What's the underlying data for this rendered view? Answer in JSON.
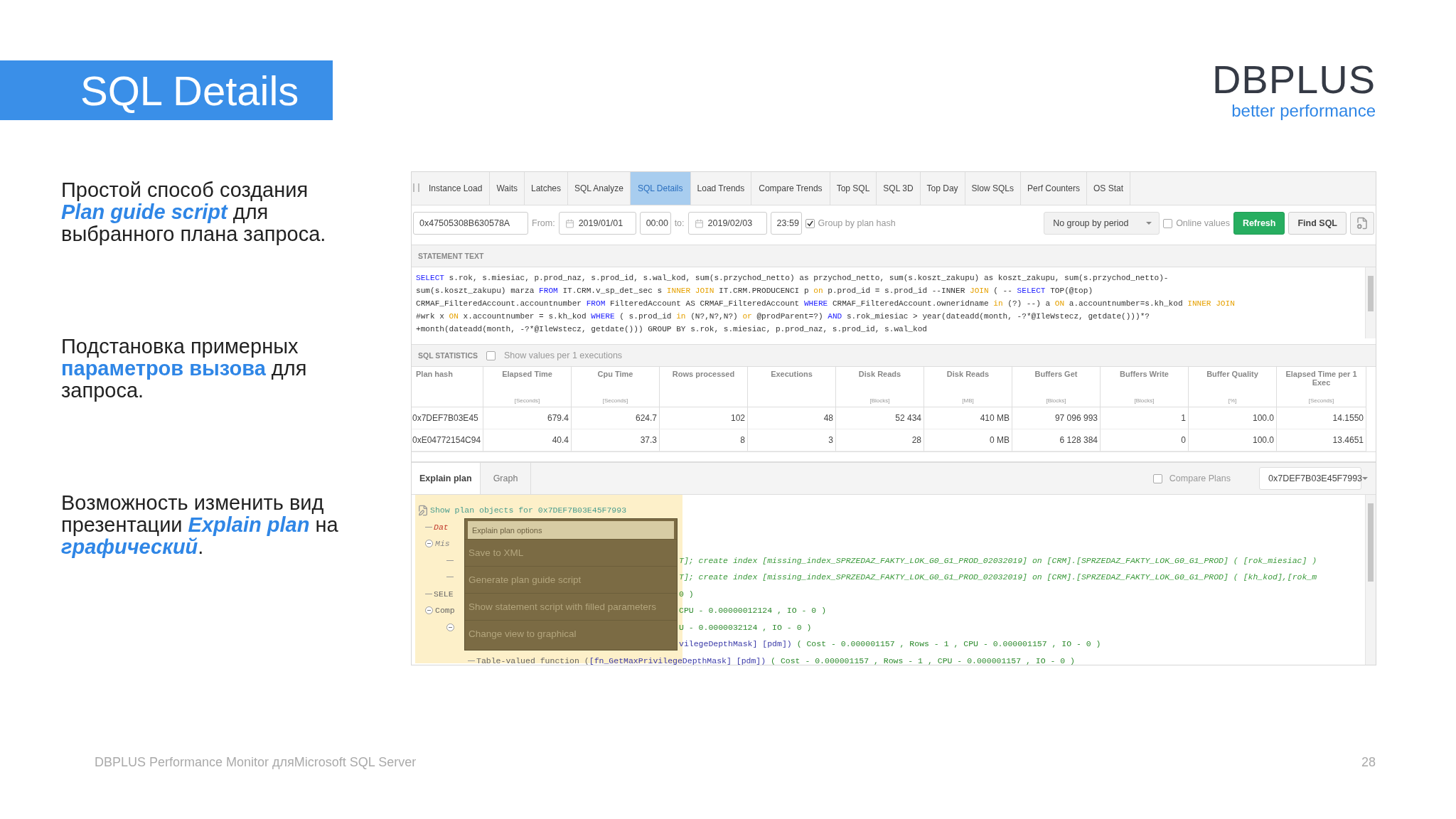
{
  "slide": {
    "title": "SQL Details",
    "logo": {
      "name": "DBPLUS",
      "tagline": "better performance"
    },
    "notes": [
      "Простой способ создания *Plan guide script* для выбранного плана запроса.",
      "Подстановка примерных **параметров вызова** для запроса.",
      "Возможность изменить вид презентации *Explain plan* на *графический*."
    ],
    "footer": {
      "text": "DBPLUS Performance Monitor дляMicrosoft SQL Server",
      "page": "28"
    }
  },
  "app": {
    "tabs": [
      {
        "label": "Instance Load",
        "selected": false
      },
      {
        "label": "Waits",
        "selected": false
      },
      {
        "label": "Latches",
        "selected": false
      },
      {
        "label": "SQL Analyze",
        "selected": false
      },
      {
        "label": "SQL Details",
        "selected": true
      },
      {
        "label": "Load Trends",
        "selected": false
      },
      {
        "label": "Compare Trends",
        "selected": false
      },
      {
        "label": "Top SQL",
        "selected": false
      },
      {
        "label": "SQL 3D",
        "selected": false
      },
      {
        "label": "Top Day",
        "selected": false
      },
      {
        "label": "Slow SQLs",
        "selected": false
      },
      {
        "label": "Perf Counters",
        "selected": false
      },
      {
        "label": "OS Stat",
        "selected": false
      }
    ],
    "toolbar": {
      "sql_hash": "0x47505308B630578A",
      "from_label": "From:",
      "from_date": "2019/01/01",
      "from_time": "00:00",
      "to_label": "to:",
      "to_date": "2019/02/03",
      "to_time": "23:59",
      "group_by_plan_hash": {
        "label": "Group by plan hash",
        "checked": true
      },
      "period": "No group by period",
      "online_values": {
        "label": "Online values",
        "checked": false
      },
      "refresh": "Refresh",
      "find_sql": "Find SQL"
    },
    "statement": {
      "title": "STATEMENT TEXT",
      "lines": [
        [
          {
            "kind": "kw",
            "text": "SELECT"
          },
          {
            "kind": "txt",
            "text": " s.rok, s.miesiac, p.prod_naz, s.prod_id, s.wal_kod, sum(s.przychod_netto) as przychod_netto, sum(s.koszt_zakupu) as koszt_zakupu, sum(s.przychod_netto)-"
          }
        ],
        [
          {
            "kind": "txt",
            "text": "sum(s.koszt_zakupu) marza "
          },
          {
            "kind": "kw",
            "text": "FROM"
          },
          {
            "kind": "txt",
            "text": " IT.CRM.v_sp_det_sec s "
          },
          {
            "kind": "op",
            "text": "INNER JOIN"
          },
          {
            "kind": "txt",
            "text": " IT.CRM.PRODUCENCI p "
          },
          {
            "kind": "op",
            "text": "on"
          },
          {
            "kind": "txt",
            "text": " p.prod_id = s.prod_id --INNER "
          },
          {
            "kind": "op",
            "text": "JOIN"
          },
          {
            "kind": "txt",
            "text": " ( -- "
          },
          {
            "kind": "kw",
            "text": "SELECT"
          },
          {
            "kind": "txt",
            "text": " TOP(@top)"
          }
        ],
        [
          {
            "kind": "txt",
            "text": "CRMAF_FilteredAccount.accountnumber "
          },
          {
            "kind": "kw",
            "text": "FROM"
          },
          {
            "kind": "txt",
            "text": " FilteredAccount AS CRMAF_FilteredAccount "
          },
          {
            "kind": "kw",
            "text": "WHERE"
          },
          {
            "kind": "txt",
            "text": " CRMAF_FilteredAccount.owneridname "
          },
          {
            "kind": "op",
            "text": "in"
          },
          {
            "kind": "txt",
            "text": " (?) --) a "
          },
          {
            "kind": "op",
            "text": "ON"
          },
          {
            "kind": "txt",
            "text": " a.accountnumber=s.kh_kod "
          },
          {
            "kind": "op",
            "text": "INNER JOIN"
          }
        ],
        [
          {
            "kind": "txt",
            "text": "#wrk x "
          },
          {
            "kind": "op",
            "text": "ON"
          },
          {
            "kind": "txt",
            "text": " x.accountnumber = s.kh_kod "
          },
          {
            "kind": "kw",
            "text": "WHERE"
          },
          {
            "kind": "txt",
            "text": " ( s.prod_id "
          },
          {
            "kind": "op",
            "text": "in"
          },
          {
            "kind": "txt",
            "text": " (N?,N?,N?) "
          },
          {
            "kind": "op",
            "text": "or"
          },
          {
            "kind": "txt",
            "text": " @prodParent=?) "
          },
          {
            "kind": "kw",
            "text": "AND"
          },
          {
            "kind": "txt",
            "text": " s.rok_miesiac > year(dateadd(month, -?*@IleWstecz, getdate()))*?"
          }
        ],
        [
          {
            "kind": "txt",
            "text": "+month(dateadd(month, -?*@IleWstecz, getdate())) GROUP BY s.rok, s.miesiac, p.prod_naz, s.prod_id, s.wal_kod"
          }
        ]
      ]
    },
    "statistics": {
      "title": "SQL STATISTICS",
      "per_exec": {
        "label": "Show values per 1 executions",
        "checked": false
      },
      "columns": [
        {
          "label": "Plan hash"
        },
        {
          "label": "Elapsed Time",
          "unit": "[Seconds]"
        },
        {
          "label": "Cpu Time",
          "unit": "[Seconds]"
        },
        {
          "label": "Rows processed"
        },
        {
          "label": "Executions"
        },
        {
          "label": "Disk Reads",
          "unit": "[Blocks]"
        },
        {
          "label": "Disk Reads",
          "unit": "[MB]"
        },
        {
          "label": "Buffers Get",
          "unit": "[Blocks]"
        },
        {
          "label": "Buffers Write",
          "unit": "[Blocks]"
        },
        {
          "label": "Buffer Quality",
          "unit": "[%]"
        },
        {
          "label": "Elapsed Time per 1 Exec",
          "unit": "[Seconds]"
        }
      ],
      "rows": [
        [
          "0x7DEF7B03E45",
          "679.4",
          "624.7",
          "102",
          "48",
          "52 434",
          "410 MB",
          "97 096 993",
          "1",
          "100.0",
          "14.1550"
        ],
        [
          "0xE04772154C94",
          "40.4",
          "37.3",
          "8",
          "3",
          "28",
          "0 MB",
          "6 128 384",
          "0",
          "100.0",
          "13.4651"
        ]
      ]
    },
    "plan": {
      "tabs": [
        {
          "label": "Explain plan",
          "selected": true
        },
        {
          "label": "Graph",
          "selected": false
        }
      ],
      "compare": {
        "label": "Compare Plans",
        "checked": false
      },
      "plan_hash": "0x7DEF7B03E45F7993",
      "tree": [
        {
          "left": [
            {
              "kind": "title",
              "text": "Show plan objects for 0x7DEF7B03E45F7993"
            }
          ],
          "children": [
            {
              "left": [
                {
                  "kind": "alert",
                  "text": "Dat"
                }
              ]
            },
            {
              "left": [
                {
                  "kind": "hint",
                  "text": "Mis"
                }
              ],
              "expanded": true,
              "children": [
                {
                  "right": [
                    {
                      "kind": "index",
                      "text": "T]; create index [missing_index_SPRZEDAZ_FAKTY_LOK_G0_G1_PROD_02032019] on [CRM].[SPRZEDAZ_FAKTY_LOK_G0_G1_PROD] ( [rok_miesiac] )"
                    }
                  ]
                },
                {
                  "right": [
                    {
                      "kind": "index",
                      "text": "T]; create index [missing_index_SPRZEDAZ_FAKTY_LOK_G0_G1_PROD_02032019] on [CRM].[SPRZEDAZ_FAKTY_LOK_G0_G1_PROD] ( [kh_kod],[rok_m"
                    }
                  ]
                }
              ]
            },
            {
              "left": [
                {
                  "kind": "node",
                  "text": "SELE"
                }
              ],
              "right": [
                {
                  "kind": "cost",
                  "text": "0 )"
                }
              ]
            },
            {
              "left": [
                {
                  "kind": "node",
                  "text": "Comp"
                }
              ],
              "right": [
                {
                  "kind": "cost",
                  "text": "CPU - 0.00000012124 , IO - 0 )"
                }
              ],
              "expanded": true,
              "children": [
                {
                  "right": [
                    {
                      "kind": "cost",
                      "text": "U - 0.0000032124 , IO - 0 )"
                    }
                  ],
                  "expanded": true,
                  "children": [
                    {
                      "right": [
                        {
                          "kind": "object",
                          "text": "vilegeDepthMask] [pdm])"
                        },
                        {
                          "kind": "cost",
                          "text": " ( Cost - 0.000001157 , Rows - 1 , CPU - 0.000001157 , IO - 0 )"
                        }
                      ]
                    },
                    {
                      "left": [
                        {
                          "kind": "node",
                          "text": "Table-valued function ("
                        },
                        {
                          "kind": "object",
                          "text": "[fn_GetMaxPrivilegeDepthMask] [pdm])"
                        },
                        {
                          "kind": "cost",
                          "text": " ( Cost - 0.000001157 , Rows - 1 , CPU - 0.000001157 , IO - 0 )"
                        }
                      ]
                    }
                  ]
                }
              ]
            }
          ]
        }
      ],
      "menu": {
        "title": "Explain plan options",
        "items": [
          "Save to XML",
          "Generate plan guide script",
          "Show statement script with filled parameters",
          "Change view to graphical"
        ]
      }
    }
  }
}
